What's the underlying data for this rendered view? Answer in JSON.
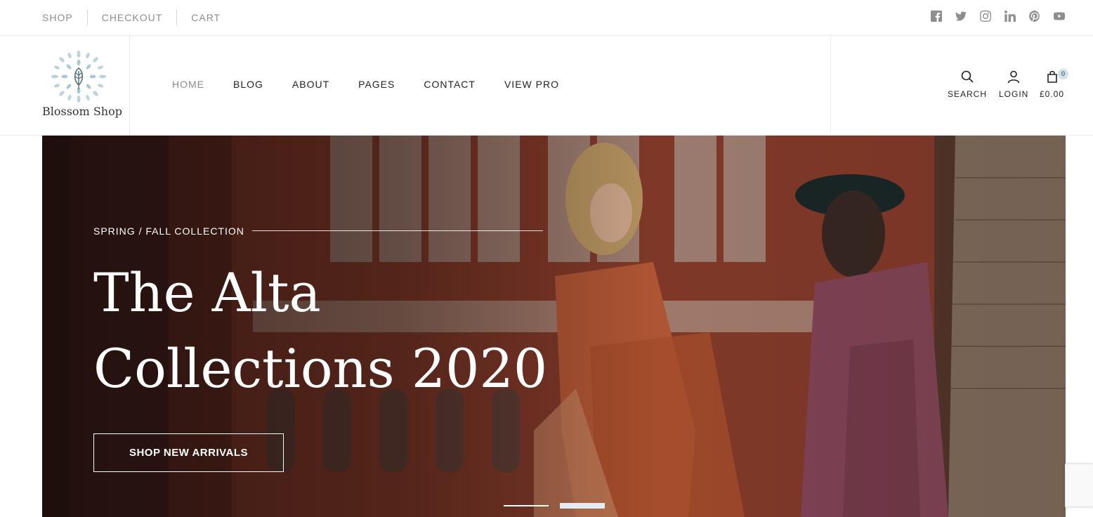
{
  "topbar": {
    "links": [
      "SHOP",
      "CHECKOUT",
      "CART"
    ],
    "social": [
      "facebook-icon",
      "twitter-icon",
      "instagram-icon",
      "linkedin-icon",
      "pinterest-icon",
      "youtube-icon"
    ]
  },
  "header": {
    "logo_text": "Blossom Shop",
    "nav": [
      "HOME",
      "BLOG",
      "ABOUT",
      "PAGES",
      "CONTACT",
      "VIEW PRO"
    ],
    "active_nav": "HOME",
    "actions": {
      "search_label": "SEARCH",
      "login_label": "LOGIN",
      "cart_total": "£0.00",
      "cart_count": "0"
    }
  },
  "hero": {
    "eyebrow": "SPRING / FALL COLLECTION",
    "title_line1": "The Alta",
    "title_line2": "Collections 2020",
    "cta_label": "SHOP NEW ARRIVALS",
    "slide_count": 2,
    "active_slide": 2
  },
  "colors": {
    "nav_inactive": "#8e8e8e",
    "nav_active": "#8a8a8a",
    "text_dark": "#222222",
    "hero_text": "#ffffff",
    "badge_bg": "#cfe1ea"
  }
}
